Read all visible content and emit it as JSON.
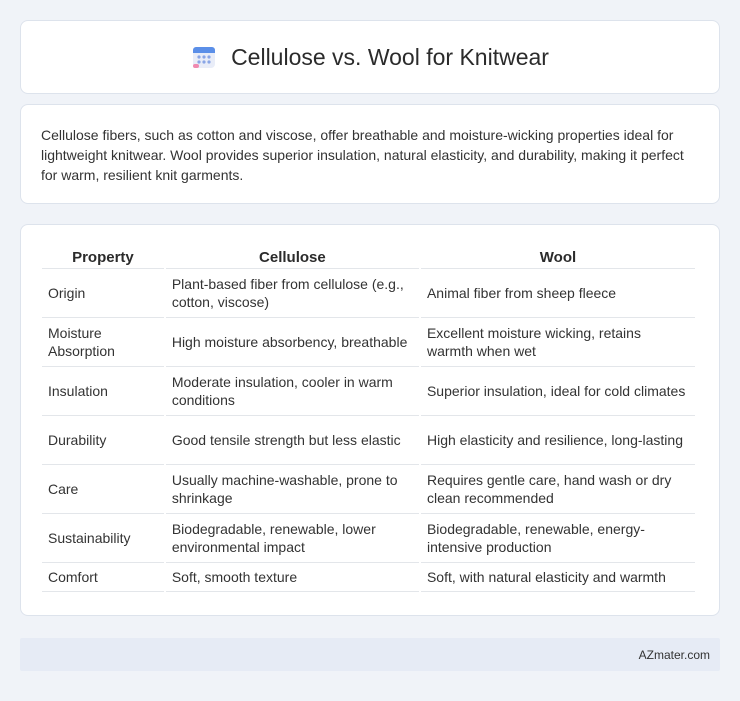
{
  "header": {
    "title": "Cellulose vs. Wool for Knitwear",
    "icon": "calendar-grid-icon"
  },
  "intro": {
    "text": "Cellulose fibers, such as cotton and viscose, offer breathable and moisture-wicking properties ideal for lightweight knitwear. Wool provides superior insulation, natural elasticity, and durability, making it perfect for warm, resilient knit garments."
  },
  "table": {
    "headers": [
      "Property",
      "Cellulose",
      "Wool"
    ],
    "rows": [
      [
        "Origin",
        "Plant-based fiber from cellulose (e.g., cotton, viscose)",
        "Animal fiber from sheep fleece"
      ],
      [
        "Moisture Absorption",
        "High moisture absorbency, breathable",
        "Excellent moisture wicking, retains warmth when wet"
      ],
      [
        "Insulation",
        "Moderate insulation, cooler in warm conditions",
        "Superior insulation, ideal for cold climates"
      ],
      [
        "Durability",
        "Good tensile strength but less elastic",
        "High elasticity and resilience, long-lasting"
      ],
      [
        "Care",
        "Usually machine-washable, prone to shrinkage",
        "Requires gentle care, hand wash or dry clean recommended"
      ],
      [
        "Sustainability",
        "Biodegradable, renewable, lower environmental impact",
        "Biodegradable, renewable, energy-intensive production"
      ],
      [
        "Comfort",
        "Soft, smooth texture",
        "Soft, with natural elasticity and warmth"
      ]
    ]
  },
  "footer": {
    "text": "AZmater.com"
  },
  "colors": {
    "background": "#f0f3f8",
    "card": "#ffffff",
    "footer": "#e6ebf5",
    "icon_blue": "#5b8fe8",
    "icon_pink": "#f08ab0"
  }
}
